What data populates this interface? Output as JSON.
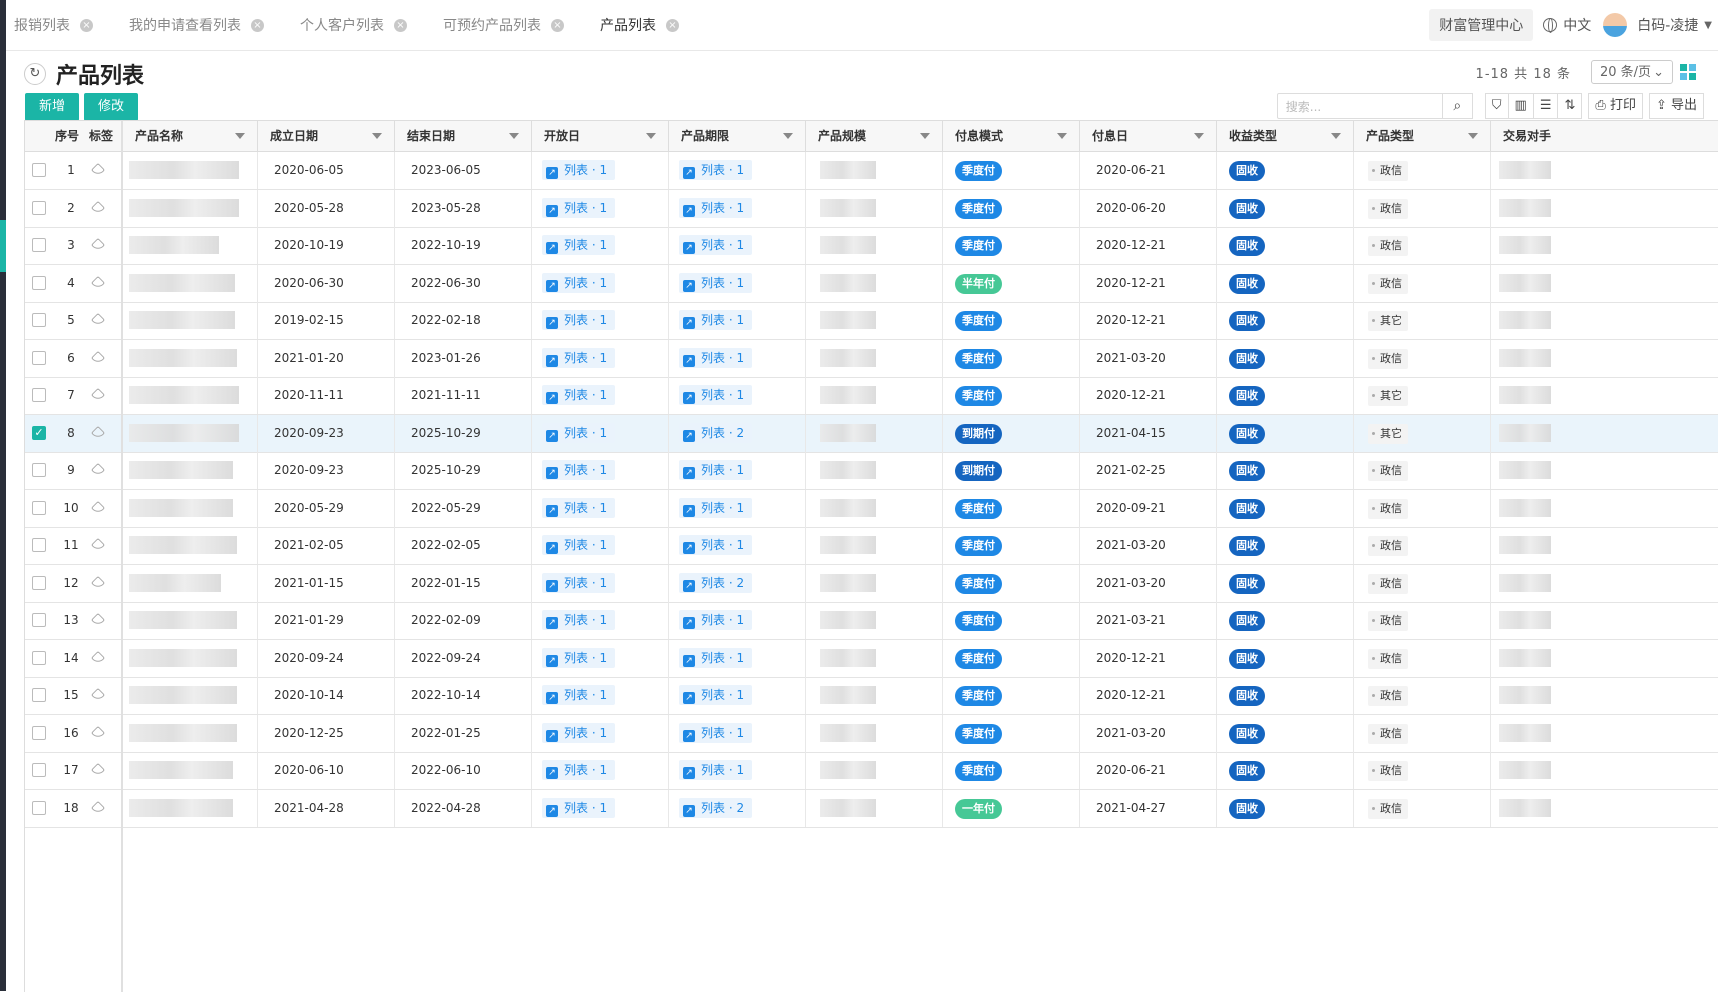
{
  "tabs": [
    {
      "label": "报销列表",
      "active": false
    },
    {
      "label": "我的申请查看列表",
      "active": false
    },
    {
      "label": "个人客户列表",
      "active": false
    },
    {
      "label": "可预约产品列表",
      "active": false
    },
    {
      "label": "产品列表",
      "active": true
    }
  ],
  "header": {
    "wealth_label": "财富管理中心",
    "language": "中文",
    "user_name": "白码-凌捷"
  },
  "page": {
    "title": "产品列表",
    "refresh_icon": "refresh-icon"
  },
  "actions": {
    "add_label": "新增",
    "edit_label": "修改"
  },
  "pager": {
    "info": "1-18 共 18 条",
    "page_size": "20 条/页"
  },
  "toolbar": {
    "search_placeholder": "搜索...",
    "print_label": "打印",
    "export_label": "导出"
  },
  "columns": {
    "seq": "序号",
    "tag": "标签",
    "name": "产品名称",
    "start": "成立日期",
    "end": "结束日期",
    "open": "开放日",
    "term": "产品期限",
    "scale": "产品规模",
    "pay_mode": "付息模式",
    "pay_day": "付息日",
    "income": "收益类型",
    "ptype": "产品类型",
    "counterparty": "交易对手"
  },
  "colors": {
    "accent": "#1bb5a6",
    "link": "#1e88e5",
    "income": "#1565c0",
    "green_pill": "#46c896"
  },
  "rows": [
    {
      "seq": "1",
      "checked": false,
      "start": "2020-06-05",
      "end": "2023-06-05",
      "open": "列表 · 1",
      "term": "列表 · 1",
      "pay_mode": "季度付",
      "pay_color": "blue",
      "pay_day": "2020-06-21",
      "income": "固收",
      "ptype": "政信"
    },
    {
      "seq": "2",
      "checked": false,
      "start": "2020-05-28",
      "end": "2023-05-28",
      "open": "列表 · 1",
      "term": "列表 · 1",
      "pay_mode": "季度付",
      "pay_color": "blue",
      "pay_day": "2020-06-20",
      "income": "固收",
      "ptype": "政信"
    },
    {
      "seq": "3",
      "checked": false,
      "start": "2020-10-19",
      "end": "2022-10-19",
      "open": "列表 · 1",
      "term": "列表 · 1",
      "pay_mode": "季度付",
      "pay_color": "blue",
      "pay_day": "2020-12-21",
      "income": "固收",
      "ptype": "政信"
    },
    {
      "seq": "4",
      "checked": false,
      "start": "2020-06-30",
      "end": "2022-06-30",
      "open": "列表 · 1",
      "term": "列表 · 1",
      "pay_mode": "半年付",
      "pay_color": "green",
      "pay_day": "2020-12-21",
      "income": "固收",
      "ptype": "政信"
    },
    {
      "seq": "5",
      "checked": false,
      "start": "2019-02-15",
      "end": "2022-02-18",
      "open": "列表 · 1",
      "term": "列表 · 1",
      "pay_mode": "季度付",
      "pay_color": "blue",
      "pay_day": "2020-12-21",
      "income": "固收",
      "ptype": "其它"
    },
    {
      "seq": "6",
      "checked": false,
      "start": "2021-01-20",
      "end": "2023-01-26",
      "open": "列表 · 1",
      "term": "列表 · 1",
      "pay_mode": "季度付",
      "pay_color": "blue",
      "pay_day": "2021-03-20",
      "income": "固收",
      "ptype": "政信"
    },
    {
      "seq": "7",
      "checked": false,
      "start": "2020-11-11",
      "end": "2021-11-11",
      "open": "列表 · 1",
      "term": "列表 · 1",
      "pay_mode": "季度付",
      "pay_color": "blue",
      "pay_day": "2020-12-21",
      "income": "固收",
      "ptype": "其它"
    },
    {
      "seq": "8",
      "checked": true,
      "start": "2020-09-23",
      "end": "2025-10-29",
      "open": "列表 · 1",
      "term": "列表 · 2",
      "pay_mode": "到期付",
      "pay_color": "dark",
      "pay_day": "2021-04-15",
      "income": "固收",
      "ptype": "其它"
    },
    {
      "seq": "9",
      "checked": false,
      "start": "2020-09-23",
      "end": "2025-10-29",
      "open": "列表 · 1",
      "term": "列表 · 1",
      "pay_mode": "到期付",
      "pay_color": "dark",
      "pay_day": "2021-02-25",
      "income": "固收",
      "ptype": "政信"
    },
    {
      "seq": "10",
      "checked": false,
      "start": "2020-05-29",
      "end": "2022-05-29",
      "open": "列表 · 1",
      "term": "列表 · 1",
      "pay_mode": "季度付",
      "pay_color": "blue",
      "pay_day": "2020-09-21",
      "income": "固收",
      "ptype": "政信"
    },
    {
      "seq": "11",
      "checked": false,
      "start": "2021-02-05",
      "end": "2022-02-05",
      "open": "列表 · 1",
      "term": "列表 · 1",
      "pay_mode": "季度付",
      "pay_color": "blue",
      "pay_day": "2021-03-20",
      "income": "固收",
      "ptype": "政信"
    },
    {
      "seq": "12",
      "checked": false,
      "start": "2021-01-15",
      "end": "2022-01-15",
      "open": "列表 · 1",
      "term": "列表 · 2",
      "pay_mode": "季度付",
      "pay_color": "blue",
      "pay_day": "2021-03-20",
      "income": "固收",
      "ptype": "政信"
    },
    {
      "seq": "13",
      "checked": false,
      "start": "2021-01-29",
      "end": "2022-02-09",
      "open": "列表 · 1",
      "term": "列表 · 1",
      "pay_mode": "季度付",
      "pay_color": "blue",
      "pay_day": "2021-03-21",
      "income": "固收",
      "ptype": "政信"
    },
    {
      "seq": "14",
      "checked": false,
      "start": "2020-09-24",
      "end": "2022-09-24",
      "open": "列表 · 1",
      "term": "列表 · 1",
      "pay_mode": "季度付",
      "pay_color": "blue",
      "pay_day": "2020-12-21",
      "income": "固收",
      "ptype": "政信"
    },
    {
      "seq": "15",
      "checked": false,
      "start": "2020-10-14",
      "end": "2022-10-14",
      "open": "列表 · 1",
      "term": "列表 · 1",
      "pay_mode": "季度付",
      "pay_color": "blue",
      "pay_day": "2020-12-21",
      "income": "固收",
      "ptype": "政信"
    },
    {
      "seq": "16",
      "checked": false,
      "start": "2020-12-25",
      "end": "2022-01-25",
      "open": "列表 · 1",
      "term": "列表 · 1",
      "pay_mode": "季度付",
      "pay_color": "blue",
      "pay_day": "2021-03-20",
      "income": "固收",
      "ptype": "政信"
    },
    {
      "seq": "17",
      "checked": false,
      "start": "2020-06-10",
      "end": "2022-06-10",
      "open": "列表 · 1",
      "term": "列表 · 1",
      "pay_mode": "季度付",
      "pay_color": "blue",
      "pay_day": "2020-06-21",
      "income": "固收",
      "ptype": "政信"
    },
    {
      "seq": "18",
      "checked": false,
      "start": "2021-04-28",
      "end": "2022-04-28",
      "open": "列表 · 1",
      "term": "列表 · 2",
      "pay_mode": "一年付",
      "pay_color": "green",
      "pay_day": "2021-04-27",
      "income": "固收",
      "ptype": "政信"
    }
  ]
}
